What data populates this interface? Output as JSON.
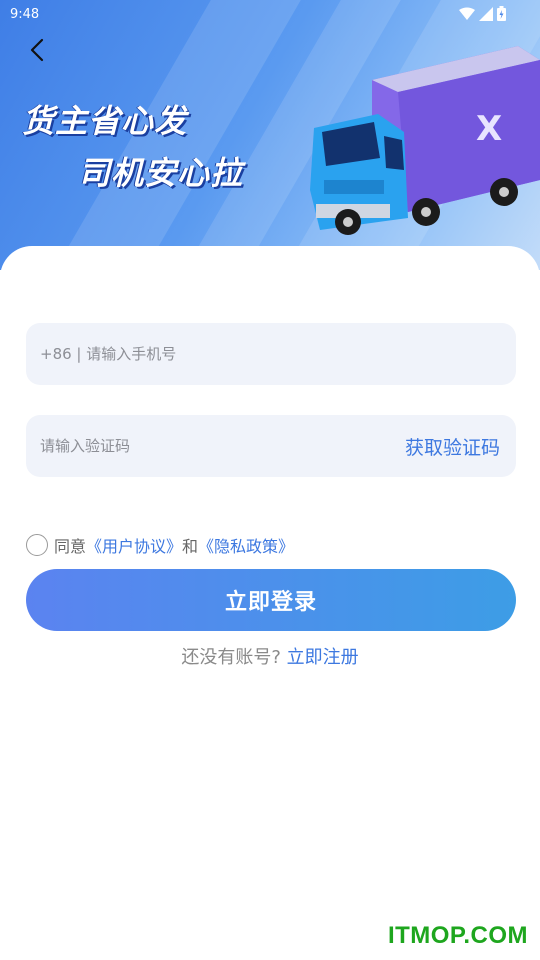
{
  "status_bar": {
    "time": "9:48"
  },
  "banner": {
    "slogan_line1": "货主省心发",
    "slogan_line2": "司机安心拉",
    "truck_logo": "X"
  },
  "form": {
    "phone_placeholder": "+86 | 请输入手机号",
    "code_placeholder": "请输入验证码",
    "get_code_label": "获取验证码"
  },
  "agreement": {
    "prefix": "同意",
    "user_agreement": "《用户协议》",
    "and": "和",
    "privacy_policy": "《隐私政策》",
    "checked": false
  },
  "login_button": "立即登录",
  "register": {
    "prompt": "还没有账号?",
    "link": "立即注册"
  },
  "watermark": "ITMOP.COM",
  "colors": {
    "accent": "#3d78e0",
    "button_start": "#5b83f0",
    "button_end": "#3d9de6",
    "watermark": "#1ea61e"
  }
}
